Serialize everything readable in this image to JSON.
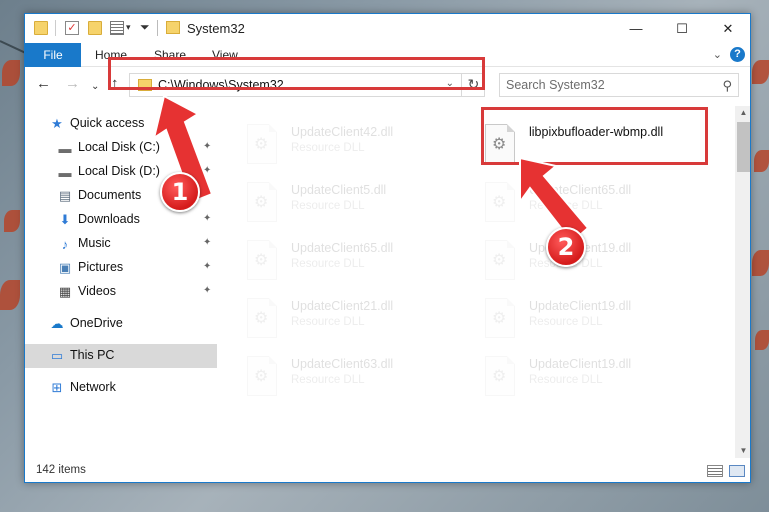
{
  "window": {
    "title": "System32",
    "controls": {
      "minimize": "—",
      "maximize": "☐",
      "close": "✕"
    }
  },
  "ribbon": {
    "tabs": [
      "File",
      "Home",
      "Share",
      "View"
    ],
    "expand": "⌄",
    "help": "?"
  },
  "address": {
    "path": "C:\\Windows\\System32",
    "dropdown": "⌄",
    "refresh": "↻"
  },
  "search": {
    "placeholder": "Search System32",
    "icon": "search-icon"
  },
  "nav_buttons": {
    "back": "←",
    "forward": "→",
    "recent": "⌄",
    "up": "↑"
  },
  "sidebar": {
    "items": [
      {
        "label": "Quick access",
        "icon": "star-icon",
        "glyph": "★",
        "color": "#2f7bd6",
        "pinned": false
      },
      {
        "label": "Local Disk (C:)",
        "icon": "drive-icon",
        "glyph": "▬",
        "color": "#6d6d6d",
        "pinned": true
      },
      {
        "label": "Local Disk (D:)",
        "icon": "drive-icon",
        "glyph": "▬",
        "color": "#6d6d6d",
        "pinned": true
      },
      {
        "label": "Documents",
        "icon": "documents-icon",
        "glyph": "▤",
        "color": "#5f6f80",
        "pinned": true
      },
      {
        "label": "Downloads",
        "icon": "download-icon",
        "glyph": "⬇",
        "color": "#2f7bd6",
        "pinned": true
      },
      {
        "label": "Music",
        "icon": "music-icon",
        "glyph": "♪",
        "color": "#2f7bd6",
        "pinned": true
      },
      {
        "label": "Pictures",
        "icon": "pictures-icon",
        "glyph": "▣",
        "color": "#4a7fb5",
        "pinned": true
      },
      {
        "label": "Videos",
        "icon": "film-icon",
        "glyph": "▦",
        "color": "#444",
        "pinned": true
      },
      {
        "label": "OneDrive",
        "icon": "cloud-icon",
        "glyph": "☁",
        "color": "#1979ca",
        "pinned": false
      },
      {
        "label": "This PC",
        "icon": "computer-icon",
        "glyph": "▭",
        "color": "#2f7bd6",
        "pinned": false,
        "selected": true
      },
      {
        "label": "Network",
        "icon": "network-icon",
        "glyph": "⊞",
        "color": "#2f7bd6",
        "pinned": false
      }
    ],
    "pin_glyph": "📌"
  },
  "files": [
    {
      "name": "UpdateClient42.dll",
      "type": "Resource DLL",
      "faded": true
    },
    {
      "name": "libpixbufloader-wbmp.dll",
      "type": "",
      "faded": false
    },
    {
      "name": "UpdateClient5.dll",
      "type": "Resource DLL",
      "faded": true
    },
    {
      "name": "UpdateClient65.dll",
      "type": "Resource DLL",
      "faded": true
    },
    {
      "name": "UpdateClient65.dll",
      "type": "Resource DLL",
      "faded": true
    },
    {
      "name": "UpdateClient19.dll",
      "type": "Resource DLL",
      "faded": true
    },
    {
      "name": "UpdateClient21.dll",
      "type": "Resource DLL",
      "faded": true
    },
    {
      "name": "UpdateClient19.dll",
      "type": "Resource DLL",
      "faded": true
    },
    {
      "name": "UpdateClient63.dll",
      "type": "Resource DLL",
      "faded": true
    },
    {
      "name": "UpdateClient19.dll",
      "type": "Resource DLL",
      "faded": true
    }
  ],
  "status": {
    "item_count": "142 items"
  },
  "annotations": {
    "step1": "1",
    "step2": "2",
    "color": "#d83a3a"
  }
}
